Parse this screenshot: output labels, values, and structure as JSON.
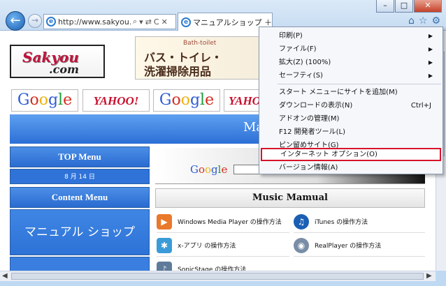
{
  "window": {
    "min": "–",
    "max": "□",
    "close": "✕"
  },
  "browser": {
    "address": "http://www.sakyou.c...",
    "addr_icons": [
      "⌕",
      "▾",
      "⇄",
      "C",
      "✕"
    ],
    "tab_label": "マニュアルショップ ＋ ダ...",
    "tab_close": "✕",
    "tools": [
      "⌂",
      "☆",
      "⚙"
    ],
    "back": "←",
    "forward": "→"
  },
  "page": {
    "logo": {
      "line1": "Sakyou",
      "line2": ".com"
    },
    "banner": {
      "small": "Bath-toilet",
      "line1": "バス・トイレ・",
      "line2": "洗濯掃除用品"
    },
    "google": "Google",
    "yahoo": "YAHOO!",
    "yahoo_partial": "YAHO",
    "bluebar_partial": "Ma",
    "top_menu": "TOP Menu",
    "date": "8 月 14 日",
    "content_menu": "Content Menu",
    "shop": "マニュアル ショップ",
    "music_title": "Music Mamual",
    "music_items": [
      "Windows Media Player の操作方法",
      "iTunes の操作方法",
      "x-アプリ の操作方法",
      "RealPlayer の操作方法",
      "SonicStage の操作方法"
    ]
  },
  "menu": {
    "group1": [
      {
        "label": "印刷(P)"
      },
      {
        "label": "ファイル(F)"
      },
      {
        "label": "拡大(Z) (100%)"
      },
      {
        "label": "セーフティ(S)"
      }
    ],
    "group2": [
      {
        "label": "スタート メニューにサイトを追加(M)"
      },
      {
        "label": "ダウンロードの表示(N)",
        "shortcut": "Ctrl+J"
      },
      {
        "label": "アドオンの管理(M)"
      },
      {
        "label": "F12 開発者ツール(L)"
      },
      {
        "label": "ピン留めサイト(G)"
      }
    ],
    "group3": [
      {
        "label": "インターネット オプション(O)"
      },
      {
        "label": "バージョン情報(A)"
      }
    ],
    "submenu_arrow": "▶"
  },
  "colors": {
    "highlight": "#d6142b",
    "nav_blue": "#2c6fd6"
  }
}
